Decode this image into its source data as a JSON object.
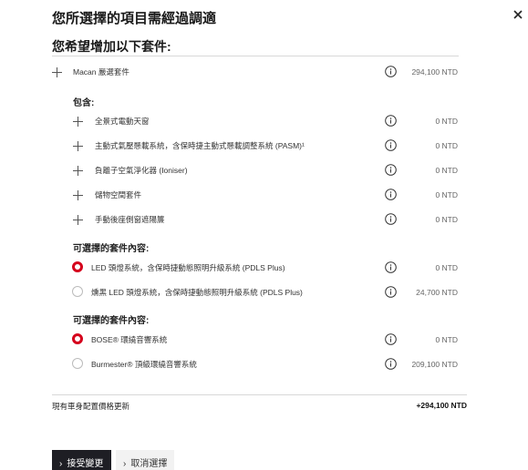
{
  "dialog": {
    "title": "您所選擇的項目需經過調適",
    "subtitle": "您希望增加以下套件:"
  },
  "main_package": {
    "label": "Macan 嚴選套件",
    "price": "294,100 NTD"
  },
  "included": {
    "heading": "包含:",
    "items": [
      {
        "label": "全景式電動天窗",
        "price": "0 NTD"
      },
      {
        "label": "主動式氣壓懸載系統，含保時捷主動式懸載調整系統 (PASM)¹",
        "price": "0 NTD"
      },
      {
        "label": "負離子空氣淨化器 (Ioniser)",
        "price": "0 NTD"
      },
      {
        "label": "儲物空間套件",
        "price": "0 NTD"
      },
      {
        "label": "手動後座側窗遮陽簾",
        "price": "0 NTD"
      }
    ]
  },
  "option_group_1": {
    "heading": "可選擇的套件內容:",
    "options": [
      {
        "label": "LED 頭燈系統，含保時捷動態照明升級系統 (PDLS Plus)",
        "price": "0 NTD",
        "selected": true
      },
      {
        "label": "燻黑 LED 頭燈系統，含保時捷動態照明升級系統 (PDLS Plus)",
        "price": "24,700 NTD",
        "selected": false
      }
    ]
  },
  "option_group_2": {
    "heading": "可選擇的套件內容:",
    "options": [
      {
        "label": "BOSE® 環繞音響系統",
        "price": "0 NTD",
        "selected": true
      },
      {
        "label": "Burmester® 頂級環繞音響系統",
        "price": "209,100 NTD",
        "selected": false
      }
    ]
  },
  "total": {
    "label": "現有車身配置價格更新",
    "value": "+294,100 NTD"
  },
  "buttons": {
    "accept": "接受變更",
    "cancel": "取消選擇"
  },
  "colors": {
    "accent": "#d5001c",
    "primary_button": "#1e1e24"
  }
}
